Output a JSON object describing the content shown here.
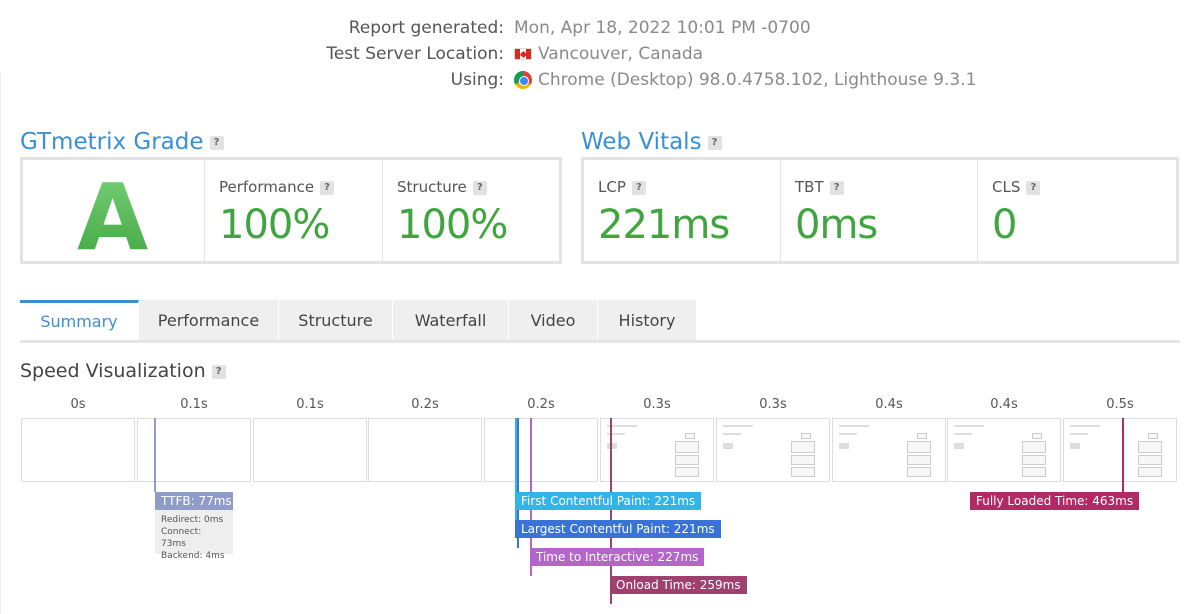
{
  "report": {
    "generated_label": "Report generated:",
    "generated_value": "Mon, Apr 18, 2022 10:01 PM -0700",
    "location_label": "Test Server Location:",
    "location_value": "Vancouver, Canada",
    "using_label": "Using:",
    "using_value": "Chrome (Desktop) 98.0.4758.102, Lighthouse 9.3.1"
  },
  "grade": {
    "title": "GTmetrix Grade",
    "help": "?",
    "letter": "A",
    "performance_label": "Performance",
    "performance_value": "100%",
    "structure_label": "Structure",
    "structure_value": "100%"
  },
  "vitals": {
    "title": "Web Vitals",
    "help": "?",
    "lcp_label": "LCP",
    "lcp_value": "221ms",
    "tbt_label": "TBT",
    "tbt_value": "0ms",
    "cls_label": "CLS",
    "cls_value": "0"
  },
  "tabs": [
    "Summary",
    "Performance",
    "Structure",
    "Waterfall",
    "Video",
    "History"
  ],
  "active_tab": "Summary",
  "speed": {
    "title": "Speed Visualization",
    "help": "?",
    "ticks": [
      "0s",
      "0.1s",
      "0.1s",
      "0.2s",
      "0.2s",
      "0.3s",
      "0.3s",
      "0.4s",
      "0.4s",
      "0.5s"
    ],
    "ttfb": "TTFB: 77ms",
    "ttfb_redirect": "Redirect: 0ms",
    "ttfb_connect": "Connect: 73ms",
    "ttfb_backend": "Backend: 4ms",
    "fcp": "First Contentful Paint: 221ms",
    "lcp": "Largest Contentful Paint: 221ms",
    "tti": "Time to Interactive: 227ms",
    "onload": "Onload Time: 259ms",
    "fully_loaded": "Fully Loaded Time: 463ms"
  },
  "colors": {
    "accent": "#3a8fd5",
    "grade_green": "#3fa53f",
    "ttfb": "#8e9cc7",
    "fcp": "#31b4e8",
    "lcp": "#3a73d6",
    "tti": "#b365c9",
    "onload": "#a0406f",
    "fully_loaded": "#b12a66"
  }
}
